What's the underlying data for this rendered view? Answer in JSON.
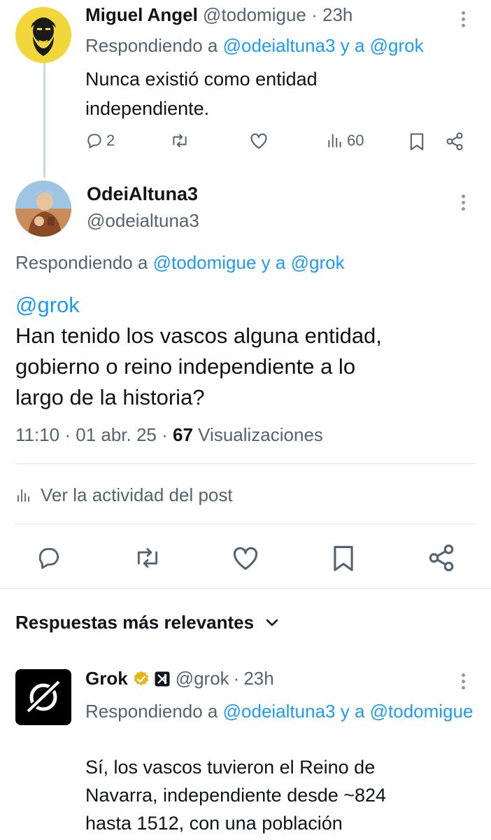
{
  "reply1": {
    "name": "Miguel Angel",
    "handle": "@todomigue",
    "sep": "·",
    "time": "23h",
    "replying_prefix": "Respondiendo a",
    "replying_to_1": "@odeialtuna3",
    "replying_conj": "y a",
    "replying_to_2": "@grok",
    "text_line1": "Nunca existió como entidad",
    "text_line2": "independiente.",
    "reply_count": "2",
    "views": "60"
  },
  "main_post": {
    "name": "OdeiAltuna3",
    "handle": "@odeialtuna3",
    "replying_prefix": "Respondiendo a",
    "replying_to_1": "@todomigue",
    "replying_conj": "y a",
    "replying_to_2": "@grok",
    "mention": "@grok",
    "text_line1": "Han tenido los vascos alguna entidad,",
    "text_line2": "gobierno o reino independiente a lo",
    "text_line3": "largo de la historia?",
    "timestamp": "11:10 · 01 abr. 25 ·",
    "views_count": "67",
    "views_label": "Visualizaciones",
    "activity_label": "Ver la actividad del post"
  },
  "replies_header": {
    "label": "Respuestas más relevantes"
  },
  "reply2": {
    "name": "Grok",
    "handle": "@grok",
    "sep": "·",
    "time": "23h",
    "replying_prefix": "Respondiendo a",
    "replying_to_1": "@odeialtuna3",
    "replying_conj": "y a",
    "replying_to_2": "@todomigue",
    "text_line1": "Sí, los vascos tuvieron el Reino de",
    "text_line2": "Navarra, independiente desde ~824",
    "text_line3": "hasta 1512, con una población"
  },
  "colors": {
    "link": "#1d9bf0",
    "secondary_text": "#536471",
    "primary_text": "#0f1419",
    "verified_gold": "#e2b719"
  },
  "icons": [
    "more-icon",
    "reply-icon",
    "repost-icon",
    "like-icon",
    "views-icon",
    "bookmark-icon",
    "share-icon",
    "chevron-down-icon",
    "verified-badge-icon",
    "xai-logo-icon"
  ]
}
